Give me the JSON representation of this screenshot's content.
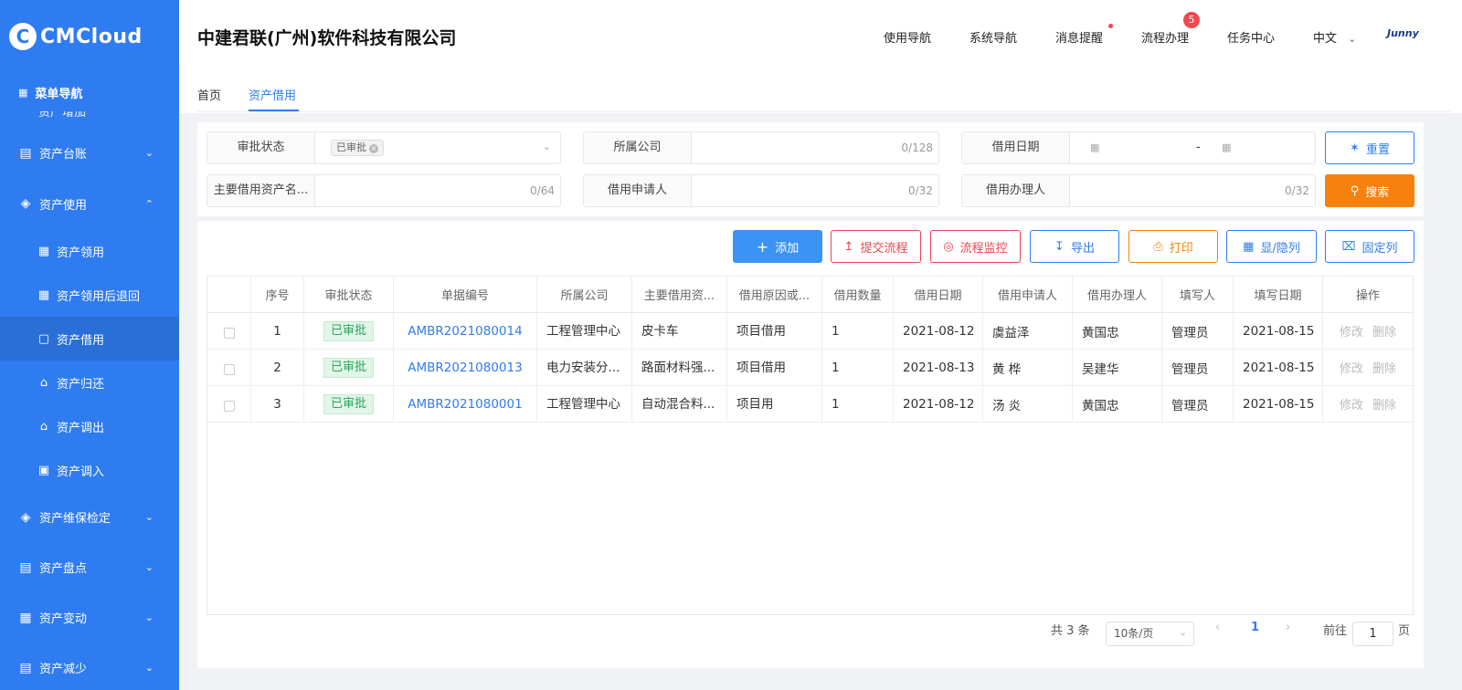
{
  "sidebar": {
    "logo_mark": "C",
    "logo_text": "CMCloud",
    "menu_title": "菜单导航",
    "menu_icon": "grid-icon",
    "cut_item": "资产增加",
    "items": [
      {
        "label": "资产台账",
        "icon": "ledger-icon",
        "expanded": false
      },
      {
        "label": "资产使用",
        "icon": "layers-icon",
        "expanded": true
      }
    ],
    "sub_items": [
      {
        "label": "资产领用",
        "icon": "building-icon"
      },
      {
        "label": "资产领用后退回",
        "icon": "building-return-icon"
      },
      {
        "label": "资产借用",
        "icon": "borrow-icon",
        "active": true
      },
      {
        "label": "资产归还",
        "icon": "return-icon"
      },
      {
        "label": "资产调出",
        "icon": "home-out-icon"
      },
      {
        "label": "资产调入",
        "icon": "truck-icon"
      }
    ],
    "bottom_items": [
      {
        "label": "资产维保检定",
        "icon": "cube-icon"
      },
      {
        "label": "资产盘点",
        "icon": "ledger-icon"
      },
      {
        "label": "资产变动",
        "icon": "apps-icon"
      },
      {
        "label": "资产减少",
        "icon": "clipboard-icon"
      }
    ]
  },
  "header": {
    "company": "中建君联(广州)软件科技有限公司",
    "nav": [
      "使用导航",
      "系统导航",
      "消息提醒",
      "流程办理",
      "任务中心"
    ],
    "badge_count": "5",
    "language": "中文",
    "brand": "Junny"
  },
  "tabs": [
    "首页",
    "资产借用"
  ],
  "filter": {
    "approval_status_label": "审批状态",
    "approval_status_tag": "已审批",
    "company_label": "所属公司",
    "company_count": "0/128",
    "borrow_date_label": "借用日期",
    "date_separator": "-",
    "asset_name_label": "主要借用资产名...",
    "asset_name_count": "0/64",
    "applicant_label": "借用申请人",
    "applicant_count": "0/32",
    "handler_label": "借用办理人",
    "handler_count": "0/32",
    "reset_label": "重置",
    "search_label": "搜索"
  },
  "toolbar": {
    "add": "添加",
    "submit_flow": "提交流程",
    "flow_monitor": "流程监控",
    "export": "导出",
    "print": "打印",
    "toggle_columns": "显/隐列",
    "fix_columns": "固定列"
  },
  "table": {
    "headers": [
      "",
      "序号",
      "审批状态",
      "单据编号",
      "所属公司",
      "主要借用资...",
      "借用原因或...",
      "借用数量",
      "借用日期",
      "借用申请人",
      "借用办理人",
      "填写人",
      "填写日期",
      "操作"
    ],
    "rows": [
      {
        "index": "1",
        "status": "已审批",
        "doc_no": "AMBR2021080014",
        "company": "工程管理中心",
        "asset": "皮卡车",
        "reason": "项目借用",
        "qty": "1",
        "date": "2021-08-12",
        "applicant": "虞益泽",
        "handler": "黄国忠",
        "filler": "管理员",
        "fill_date": "2021-08-15",
        "edit": "修改",
        "delete": "删除"
      },
      {
        "index": "2",
        "status": "已审批",
        "doc_no": "AMBR2021080013",
        "company": "电力安装分...",
        "asset": "路面材料强...",
        "reason": "项目借用",
        "qty": "1",
        "date": "2021-08-13",
        "applicant": "黄 桦",
        "handler": "吴建华",
        "filler": "管理员",
        "fill_date": "2021-08-15",
        "edit": "修改",
        "delete": "删除"
      },
      {
        "index": "3",
        "status": "已审批",
        "doc_no": "AMBR2021080001",
        "company": "工程管理中心",
        "asset": "自动混合料...",
        "reason": "项目用",
        "qty": "1",
        "date": "2021-08-12",
        "applicant": "汤 炎",
        "handler": "黄国忠",
        "filler": "管理员",
        "fill_date": "2021-08-15",
        "edit": "修改",
        "delete": "删除"
      }
    ]
  },
  "pagination": {
    "total": "共 3 条",
    "page_size": "10条/页",
    "current_page": "1",
    "goto_label": "前往",
    "goto_value": "1",
    "page_unit": "页"
  },
  "colors": {
    "primary": "#2f7cf0",
    "sidebar_active": "#2a6fd6",
    "danger": "#e8464f",
    "orange": "#f5820e",
    "success": "#2da55d"
  }
}
